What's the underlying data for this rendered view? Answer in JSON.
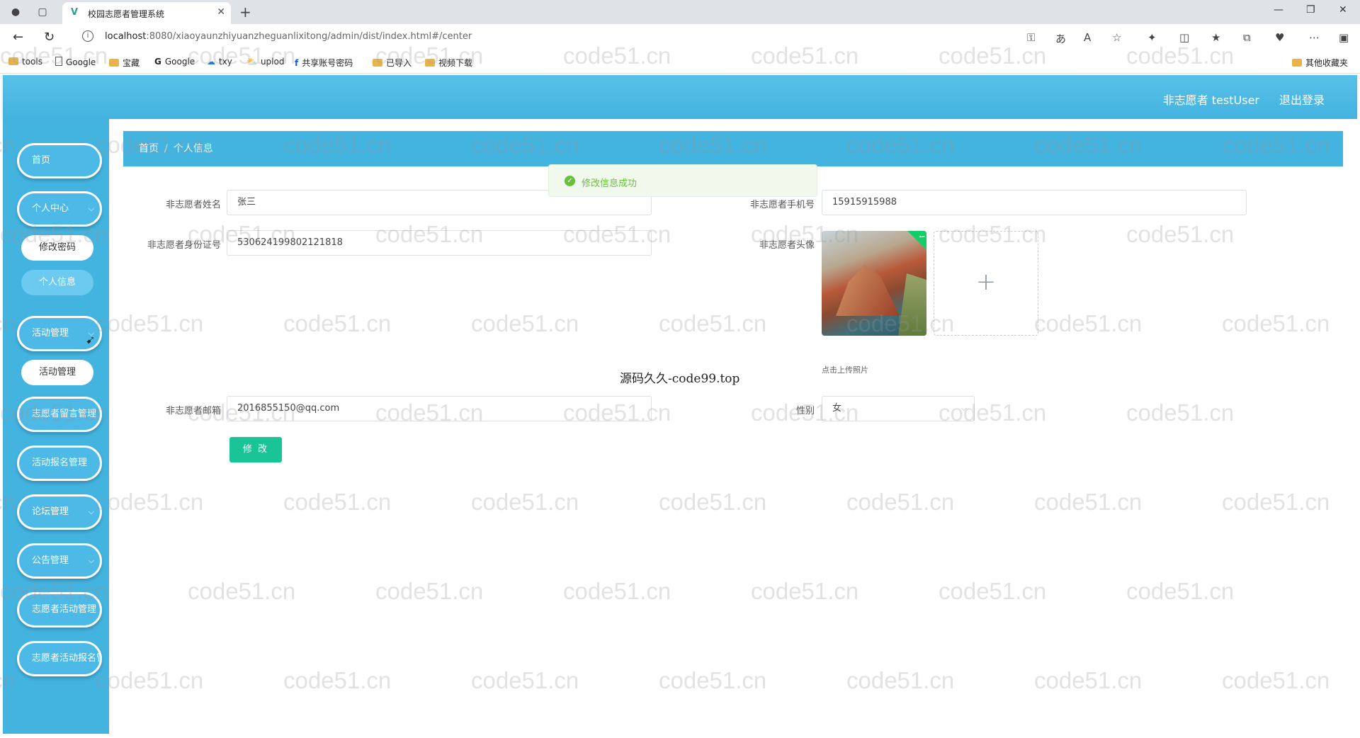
{
  "browser": {
    "tab_title": "校园志愿者管理系统",
    "url_host": "localhost",
    "url_rest": ":8080/xiaoyaunzhiyuanzheguanlixitong/admin/dist/index.html#/center",
    "bookmarks": [
      "tools",
      "Google",
      "宝藏",
      "Google",
      "txy",
      "uplod",
      "共享账号密码",
      "已导入",
      "视频下载"
    ],
    "other_bookmarks": "其他收藏夹"
  },
  "header": {
    "user_label": "非志愿者 testUser",
    "logout": "退出登录"
  },
  "toast": {
    "message": "修改信息成功"
  },
  "sidebar": {
    "items": [
      {
        "label": "首页"
      },
      {
        "label": "个人中心"
      },
      {
        "label": "修改密码"
      },
      {
        "label": "个人信息"
      },
      {
        "label": "活动管理"
      },
      {
        "label": "活动管理"
      },
      {
        "label": "志愿者留言管理"
      },
      {
        "label": "活动报名管理"
      },
      {
        "label": "论坛管理"
      },
      {
        "label": "公告管理"
      },
      {
        "label": "志愿者活动管理"
      },
      {
        "label": "志愿者活动报名管理"
      }
    ]
  },
  "breadcrumb": {
    "home": "首页",
    "separator": "/",
    "current": "个人信息"
  },
  "form": {
    "name_label": "非志愿者姓名",
    "name_value": "张三",
    "phone_label": "非志愿者手机号",
    "phone_value": "15915915988",
    "id_label": "非志愿者身份证号",
    "id_value": "530624199802121818",
    "avatar_label": "非志愿者头像",
    "upload_tip": "点击上传照片",
    "email_label": "非志愿者邮箱",
    "email_value": "2016855150@qq.com",
    "gender_label": "性别",
    "gender_value": "女",
    "submit": "修 改"
  },
  "overlay_text": "源码久久-code99.top",
  "watermark": "code51.cn"
}
